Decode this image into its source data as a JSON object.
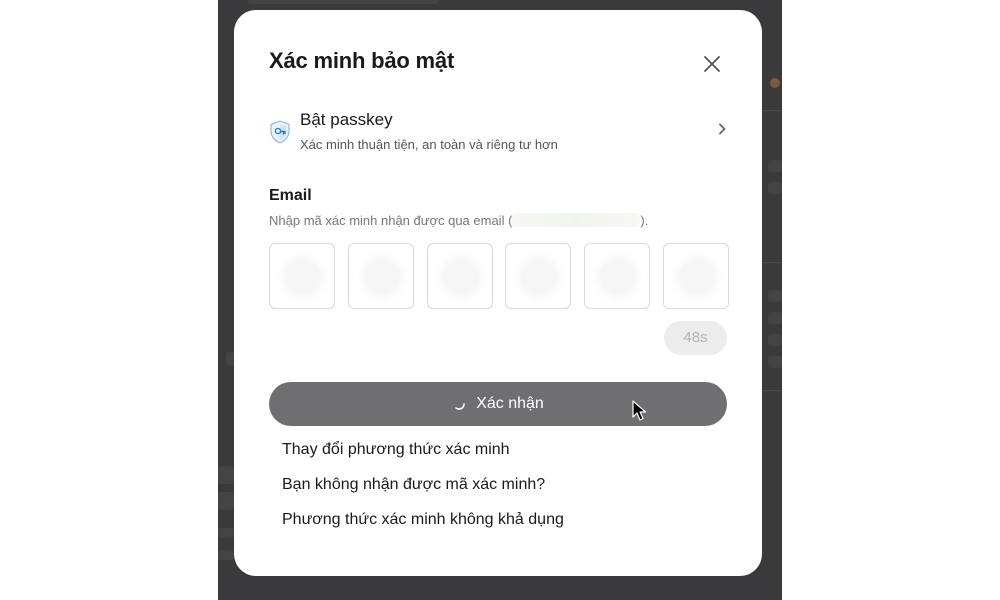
{
  "modal": {
    "title": "Xác minh bảo mật",
    "close_icon": "close-icon"
  },
  "passkey": {
    "icon": "shield-passkey-icon",
    "title": "Bật passkey",
    "subtitle": "Xác minh thuận tiện, an toàn và riêng tư hơn",
    "chevron_icon": "chevron-right-icon"
  },
  "email": {
    "label": "Email",
    "hint_prefix": "Nhập mã xác minh nhận được qua email (",
    "hint_suffix": ")."
  },
  "code_inputs": [
    {
      "value": ""
    },
    {
      "value": ""
    },
    {
      "value": ""
    },
    {
      "value": ""
    },
    {
      "value": ""
    },
    {
      "value": ""
    }
  ],
  "resend": {
    "countdown_label": "48s"
  },
  "confirm": {
    "label": "Xác nhận",
    "loading": true,
    "spinner_icon": "loading-spinner-icon"
  },
  "links": {
    "change_method": "Thay đổi phương thức xác minh",
    "no_code": "Bạn không nhận được mã xác minh?",
    "method_unavailable": "Phương thức xác minh không khả dụng"
  },
  "colors": {
    "overlay": "#3a3a3c",
    "confirm_button": "#6f6f71",
    "resend_button": "#ececec",
    "input_border": "#d9d9d9"
  }
}
